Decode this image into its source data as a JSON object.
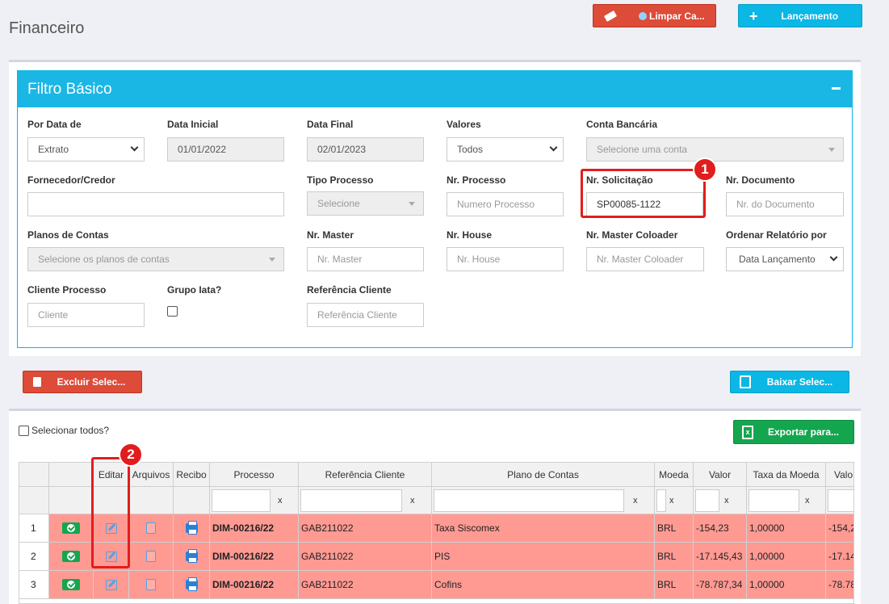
{
  "page": {
    "title": "Financeiro"
  },
  "top_buttons": {
    "clear_label": "Limpar Ca...",
    "new_label": "Lançamento"
  },
  "filter": {
    "title": "Filtro Básico",
    "por_data_de": {
      "label": "Por Data de",
      "value": "Extrato"
    },
    "data_inicial": {
      "label": "Data Inicial",
      "value": "01/01/2022"
    },
    "data_final": {
      "label": "Data Final",
      "value": "02/01/2023"
    },
    "valores": {
      "label": "Valores",
      "value": "Todos"
    },
    "conta_bancaria": {
      "label": "Conta Bancária",
      "placeholder": "Selecione uma conta"
    },
    "fornecedor": {
      "label": "Fornecedor/Credor"
    },
    "tipo_processo": {
      "label": "Tipo Processo",
      "placeholder": "Selecione"
    },
    "nr_processo": {
      "label": "Nr. Processo",
      "placeholder": "Numero Processo"
    },
    "nr_solicitacao": {
      "label": "Nr. Solicitação",
      "value": "SP00085-1122"
    },
    "nr_documento": {
      "label": "Nr. Documento",
      "placeholder": "Nr. do Documento"
    },
    "planos_contas": {
      "label": "Planos de Contas",
      "placeholder": "Selecione os planos de contas"
    },
    "nr_master": {
      "label": "Nr. Master",
      "placeholder": "Nr. Master"
    },
    "nr_house": {
      "label": "Nr. House",
      "placeholder": "Nr. House"
    },
    "nr_master_coloader": {
      "label": "Nr. Master Coloader",
      "placeholder": "Nr. Master Coloader"
    },
    "ordenar": {
      "label": "Ordenar Relatório por",
      "value": "Data Lançamento"
    },
    "cliente_processo": {
      "label": "Cliente Processo",
      "placeholder": "Cliente"
    },
    "grupo_iata": {
      "label": "Grupo Iata?"
    },
    "referencia_cliente": {
      "label": "Referência Cliente",
      "placeholder": "Referência Cliente"
    }
  },
  "actions": {
    "delete_label": "Excluir Selec...",
    "download_label": "Baixar Selec...",
    "export_label": "Exportar para...",
    "select_all_label": "Selecionar todos?"
  },
  "annotations": [
    "1",
    "2"
  ],
  "grid": {
    "headers": [
      "",
      "",
      "Editar",
      "Arquivos",
      "Recibo",
      "Processo",
      "Referência Cliente",
      "Plano de Contas",
      "Moeda",
      "Valor",
      "Taxa da Moeda",
      "Valo"
    ],
    "filter_clear": "x",
    "rows": [
      {
        "n": "1",
        "processo": "DIM-00216/22",
        "ref": "GAB211022",
        "plano": "Taxa Siscomex",
        "moeda": "BRL",
        "valor": "-154,23",
        "taxa": "1,00000",
        "valo": "-154,2"
      },
      {
        "n": "2",
        "processo": "DIM-00216/22",
        "ref": "GAB211022",
        "plano": "PIS",
        "moeda": "BRL",
        "valor": "-17.145,43",
        "taxa": "1,00000",
        "valo": "-17.14"
      },
      {
        "n": "3",
        "processo": "DIM-00216/22",
        "ref": "GAB211022",
        "plano": "Cofins",
        "moeda": "BRL",
        "valor": "-78.787,34",
        "taxa": "1,00000",
        "valo": "-78.78"
      }
    ]
  }
}
